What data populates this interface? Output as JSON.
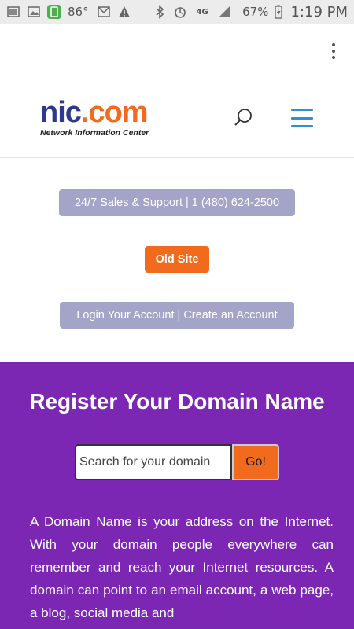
{
  "status_bar": {
    "temperature": "86°",
    "battery_percent": "67%",
    "time": "1:19 PM",
    "network": "4G"
  },
  "logo": {
    "brand_part1": "nic",
    "brand_part2": ".com",
    "tagline": "Network Information Center"
  },
  "buttons": {
    "support": "24/7 Sales & Support | 1 (480) 624-2500",
    "old_site": "Old Site",
    "account": "Login Your Account | Create an Account"
  },
  "hero": {
    "title": "Register Your Domain Name",
    "search_placeholder": "Search for your domain",
    "go_label": "Go!",
    "description": "A  Domain Name is your address on the Internet. With your domain people everywhere can remember and reach your Internet resources. A domain can point to an email account, a web page, a blog, social media and"
  },
  "colors": {
    "brand_blue": "#2d3a8c",
    "brand_orange": "#f26a1b",
    "purple_bg": "#7b27b4",
    "pill_gray": "#a3a4c8",
    "menu_blue": "#2e8fd6"
  }
}
